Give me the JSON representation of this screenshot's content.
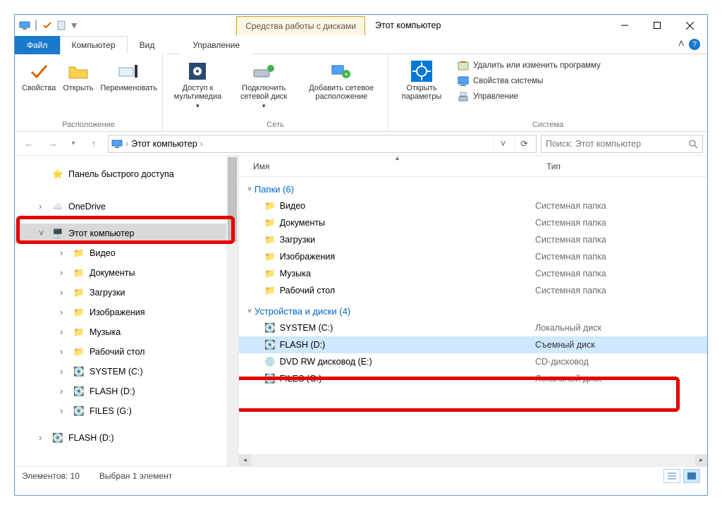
{
  "window": {
    "drive_tools_tab": "Средства работы с дисками",
    "title": "Этот компьютер"
  },
  "tabs": {
    "file": "Файл",
    "computer": "Компьютер",
    "view": "Вид",
    "manage": "Управление"
  },
  "ribbon": {
    "group_location": {
      "label": "Расположение",
      "properties": "Свойства",
      "open": "Открыть",
      "rename": "Переименовать"
    },
    "group_network": {
      "label": "Сеть",
      "media_access": "Доступ к мультимедиа",
      "map_drive": "Подключить сетевой диск",
      "add_net_location": "Добавить сетевое расположение"
    },
    "group_system": {
      "label": "Система",
      "open_settings": "Открыть параметры",
      "uninstall": "Удалить или изменить программу",
      "sys_props": "Свойства системы",
      "manage": "Управление"
    }
  },
  "address": {
    "location": "Этот компьютер",
    "search_placeholder": "Поиск: Этот компьютер"
  },
  "nav": {
    "quick_access": "Панель быстрого доступа",
    "onedrive": "OneDrive",
    "this_pc": "Этот компьютер",
    "videos": "Видео",
    "documents": "Документы",
    "downloads": "Загрузки",
    "pictures": "Изображения",
    "music": "Музыка",
    "desktop": "Рабочий стол",
    "system_c": "SYSTEM (C:)",
    "flash_d_nav": "FLASH (D:)",
    "files_g": "FILES (G:)",
    "flash_d2": "FLASH (D:)"
  },
  "columns": {
    "name": "Имя",
    "type": "Тип"
  },
  "groups": {
    "folders": {
      "label": "Папки (6)"
    },
    "drives": {
      "label": "Устройства и диски (4)"
    }
  },
  "items": {
    "videos": {
      "name": "Видео",
      "type": "Системная папка"
    },
    "documents": {
      "name": "Документы",
      "type": "Системная папка"
    },
    "downloads": {
      "name": "Загрузки",
      "type": "Системная папка"
    },
    "pictures": {
      "name": "Изображения",
      "type": "Системная папка"
    },
    "music": {
      "name": "Музыка",
      "type": "Системная папка"
    },
    "desktop": {
      "name": "Рабочий стол",
      "type": "Системная папка"
    },
    "system_c": {
      "name": "SYSTEM (C:)",
      "type": "Локальный диск"
    },
    "flash_d": {
      "name": "FLASH (D:)",
      "type": "Съемный диск"
    },
    "dvd_e": {
      "name": "DVD RW дисковод (E:)",
      "type": "CD-дисковод"
    },
    "files_g": {
      "name": "FILES (G:)",
      "type": "Локальный диск"
    }
  },
  "status": {
    "count": "Элементов: 10",
    "selected": "Выбран 1 элемент"
  }
}
